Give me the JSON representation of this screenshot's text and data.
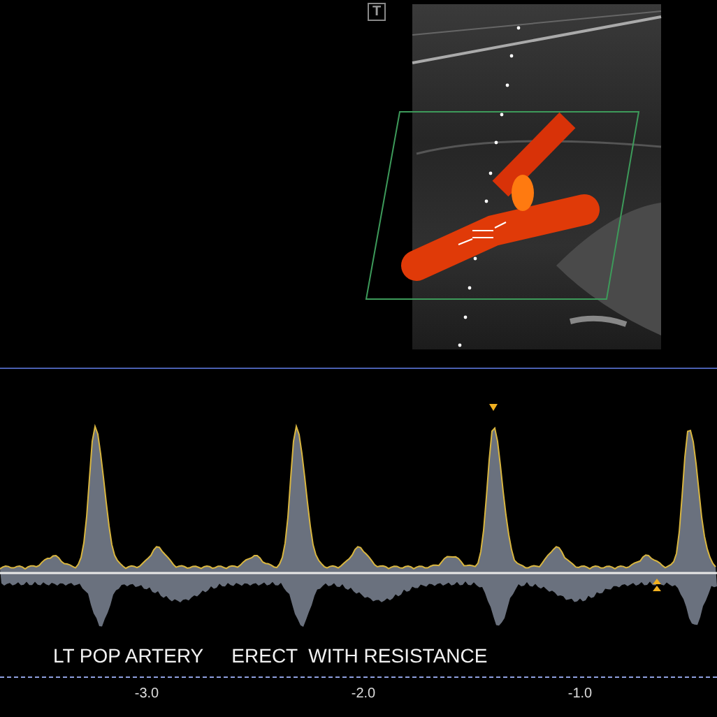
{
  "image_panel": {
    "mode_badge": "T"
  },
  "doppler": {
    "annotations": [
      "LT POP ARTERY",
      "ERECT  WITH RESISTANCE"
    ],
    "time_axis": {
      "ticks": [
        "-3.0",
        "-2.0",
        "-1.0"
      ]
    }
  }
}
